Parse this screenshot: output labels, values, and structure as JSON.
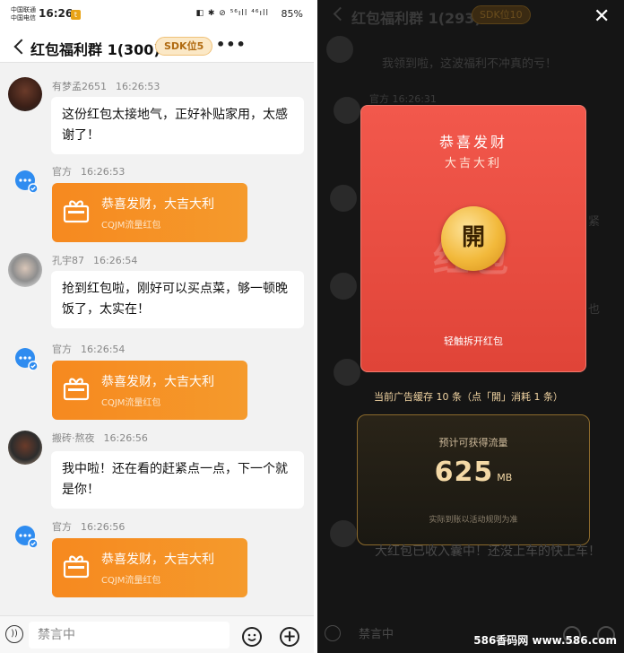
{
  "status_bar": {
    "carrier1": "中国联通",
    "carrier2": "中国电信",
    "time": "16:26",
    "badge": "t",
    "icons": "◧ ✱ ⊘ ⁵⁶ıll ⁴⁶ıll",
    "battery": "85%"
  },
  "header": {
    "title": "红包福利群 1(300)",
    "sdk_badge": "SDK位5",
    "more": "•••"
  },
  "messages": [
    {
      "sender": "有梦孟2651",
      "time": "16:26:53",
      "text": "这份红包太接地气，正好补贴家用，太感谢了！"
    },
    {
      "sender": "官方",
      "time": "16:26:53",
      "packet_title": "恭喜发财，大吉大利",
      "packet_sub": "CQJM流量红包"
    },
    {
      "sender": "孔宇87",
      "time": "16:26:54",
      "text": "抢到红包啦，刚好可以买点菜，够一顿晚饭了，太实在！"
    },
    {
      "sender": "官方",
      "time": "16:26:54",
      "packet_title": "恭喜发财，大吉大利",
      "packet_sub": "CQJM流量红包"
    },
    {
      "sender": "搬砖·熬夜",
      "time": "16:26:56",
      "text": "我中啦！还在看的赶紧点一点，下一个就是你！"
    },
    {
      "sender": "官方",
      "time": "16:26:56",
      "packet_title": "恭喜发财，大吉大利",
      "packet_sub": "CQJM流量红包"
    }
  ],
  "input_bar": {
    "placeholder": "禁言中"
  },
  "right": {
    "title": "红包福利群 1(293)",
    "sdk_badge": "SDK位10",
    "close": "✕",
    "bg_message": "我领到啦，这波福利不冲真的亏！",
    "bg_sender": "官方",
    "bg_time": "16:26:31",
    "bg_fragment1": "紧",
    "bg_fragment2": "也",
    "envelope": {
      "title": "恭喜发财",
      "subtitle": "大吉大利",
      "watermark": "红包",
      "open_label": "開",
      "hint": "轻触拆开红包"
    },
    "cache_note": "当前广告缓存 10 条（点「開」消耗 1 条）",
    "flow": {
      "label": "预计可获得流量",
      "value": "625",
      "unit": "MB",
      "note": "实际到账以活动规则为准"
    },
    "bottom_message": "大红包已收入囊中！还没上车的快上车！",
    "input_placeholder": "禁言中",
    "watermark": "586香码网 www.586.com"
  }
}
